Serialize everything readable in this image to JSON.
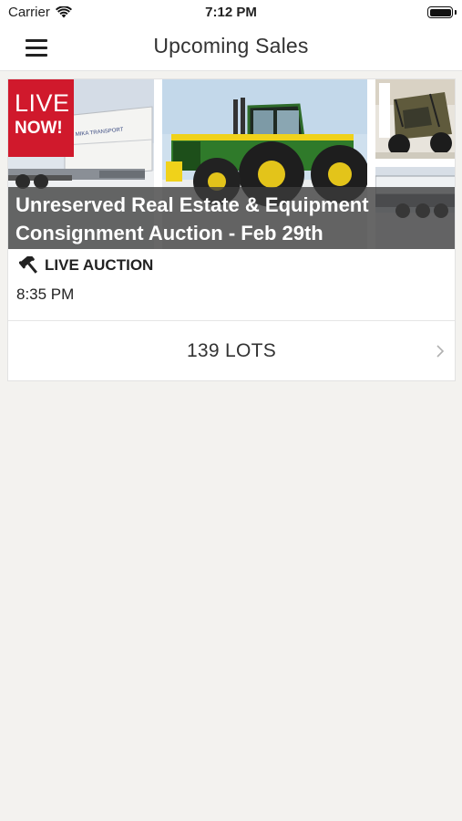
{
  "status_bar": {
    "carrier": "Carrier",
    "time": "7:12 PM"
  },
  "nav": {
    "title": "Upcoming Sales",
    "menu_icon": "hamburger-menu-icon"
  },
  "sale_card": {
    "badge_line1": "LIVE",
    "badge_line2": "NOW!",
    "title": "Unreserved Real Estate & Equipment Consignment Auction - Feb 29th",
    "auction_type": "LIVE AUCTION",
    "auction_icon": "gavel-icon",
    "time": "8:35 PM",
    "lots": "139 LOTS",
    "trailer_text": "MIKA TRANSPORT"
  },
  "colors": {
    "accent_red": "#d0192c",
    "background": "#f3f2ef",
    "card": "#ffffff",
    "overlay": "#3c3c3c"
  }
}
